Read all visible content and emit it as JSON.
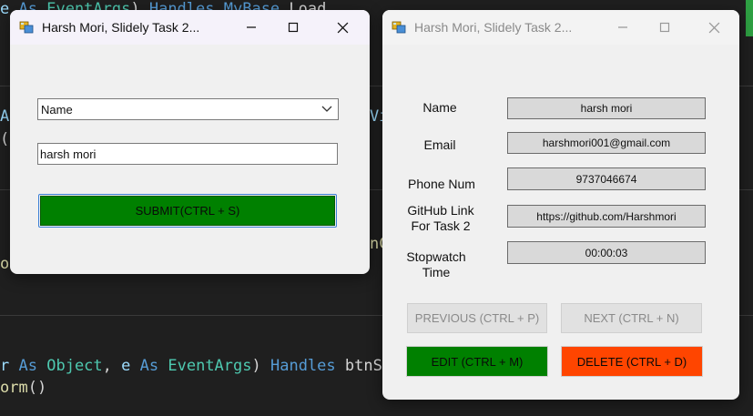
{
  "editor": {
    "line1_a": "e As EventArgs) Handles MyBase.Load",
    "line2_a": "r As Object, e As EventArgs) Handles btnS",
    "line3_a": "orm()"
  },
  "window1": {
    "title": "Harsh Mori, Slidely Task 2...",
    "select_value": "Name",
    "input_value": "harsh mori",
    "submit_label": "SUBMIT(CTRL + S)"
  },
  "window2": {
    "title": "Harsh Mori, Slidely Task 2...",
    "labels": {
      "name": "Name",
      "email": "Email",
      "phone": "Phone Num",
      "github_line1": "GitHub Link",
      "github_line2": "For Task 2",
      "stopwatch_line1": "Stopwatch",
      "stopwatch_line2": "Time"
    },
    "values": {
      "name": "harsh mori",
      "email": "harshmori001@gmail.com",
      "phone": "9737046674",
      "github": "https://github.com/Harshmori",
      "stopwatch": "00:00:03"
    },
    "buttons": {
      "previous": "PREVIOUS (CTRL + P)",
      "next": "NEXT (CTRL + N)",
      "edit": "EDIT (CTRL + M)",
      "delete": "DELETE (CTRL + D)"
    }
  },
  "colors": {
    "submit_bg": "#008000",
    "edit_bg": "#008000",
    "delete_bg": "#ff4500",
    "disabled_bg": "#e1e1e1"
  }
}
